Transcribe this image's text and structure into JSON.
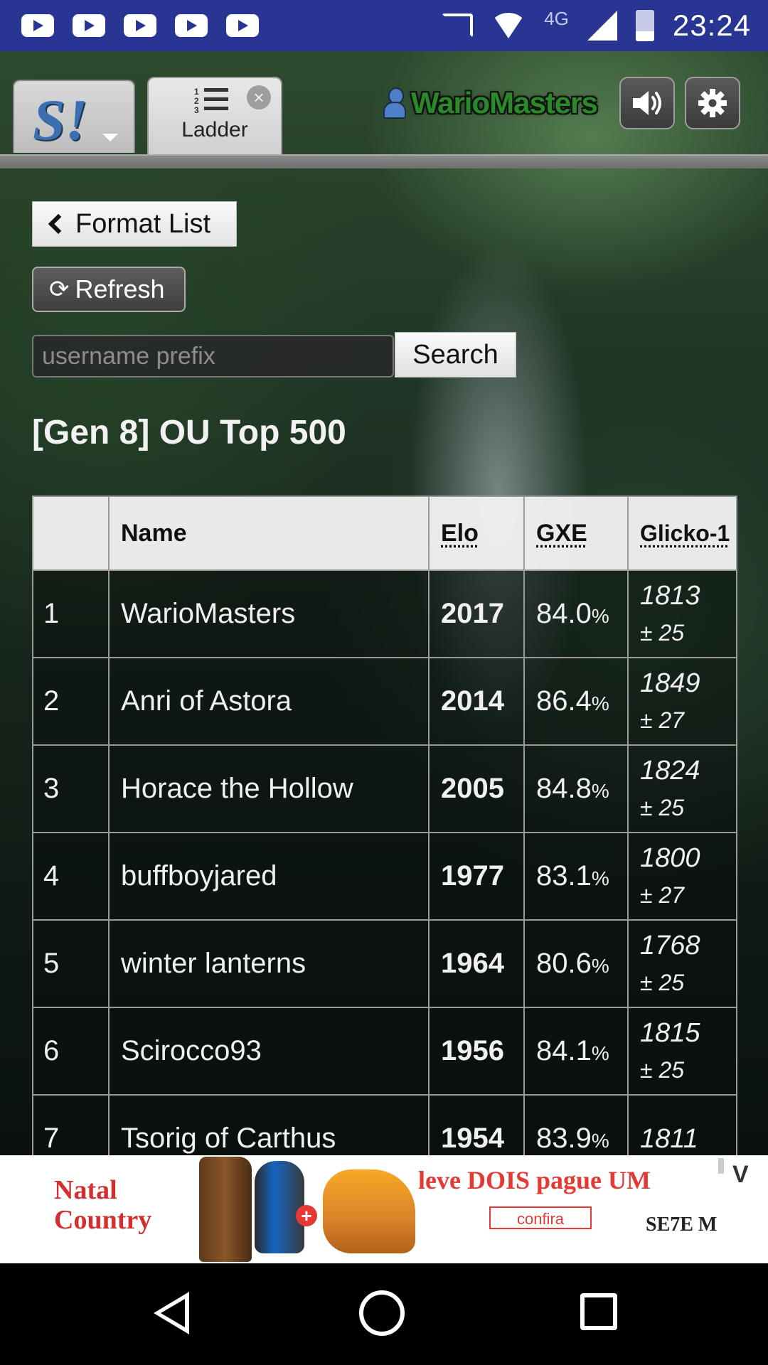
{
  "status_bar": {
    "time": "23:24",
    "network": "4G",
    "notification_icons": [
      "youtube-icon",
      "youtube-icon",
      "youtube-icon",
      "youtube-icon",
      "youtube-icon"
    ],
    "system_icons": [
      "cast-icon",
      "wifi-icon",
      "signal-icon",
      "battery-icon"
    ]
  },
  "tabs": {
    "logo_text": "S!",
    "ladder_label": "Ladder"
  },
  "header": {
    "username": "WarioMasters"
  },
  "controls": {
    "format_list_label": "Format List",
    "refresh_label": "Refresh",
    "search_placeholder": "username prefix",
    "search_label": "Search"
  },
  "ladder": {
    "title": "[Gen 8] OU Top 500",
    "columns": {
      "rank": "",
      "name": "Name",
      "elo": "Elo",
      "gxe": "GXE",
      "glicko": "Glicko-1"
    },
    "rows": [
      {
        "rank": "1",
        "name": "WarioMasters",
        "elo": "2017",
        "gxe": "84.0",
        "gxe_unit": "%",
        "glicko": "1813",
        "glicko_dev": "± 25"
      },
      {
        "rank": "2",
        "name": "Anri of Astora",
        "elo": "2014",
        "gxe": "86.4",
        "gxe_unit": "%",
        "glicko": "1849",
        "glicko_dev": "± 27"
      },
      {
        "rank": "3",
        "name": "Horace the Hollow",
        "elo": "2005",
        "gxe": "84.8",
        "gxe_unit": "%",
        "glicko": "1824",
        "glicko_dev": "± 25"
      },
      {
        "rank": "4",
        "name": "buffboyjared",
        "elo": "1977",
        "gxe": "83.1",
        "gxe_unit": "%",
        "glicko": "1800",
        "glicko_dev": "± 27"
      },
      {
        "rank": "5",
        "name": "winter lanterns",
        "elo": "1964",
        "gxe": "80.6",
        "gxe_unit": "%",
        "glicko": "1768",
        "glicko_dev": "± 25"
      },
      {
        "rank": "6",
        "name": "Scirocco93",
        "elo": "1956",
        "gxe": "84.1",
        "gxe_unit": "%",
        "glicko": "1815",
        "glicko_dev": "± 25"
      },
      {
        "rank": "7",
        "name": "Tsorig of Carthus",
        "elo": "1954",
        "gxe": "83.9",
        "gxe_unit": "%",
        "glicko": "1811",
        "glicko_dev": ""
      }
    ]
  },
  "ad": {
    "brand_line1": "Natal",
    "brand_line2": "Country",
    "promo": "leve DOIS pague UM",
    "cta": "confira",
    "logo": "SE7E M",
    "close_label": "V"
  },
  "colors": {
    "status_bar": "#283593",
    "username": "#2a8a2a",
    "ad_accent": "#e53935"
  }
}
